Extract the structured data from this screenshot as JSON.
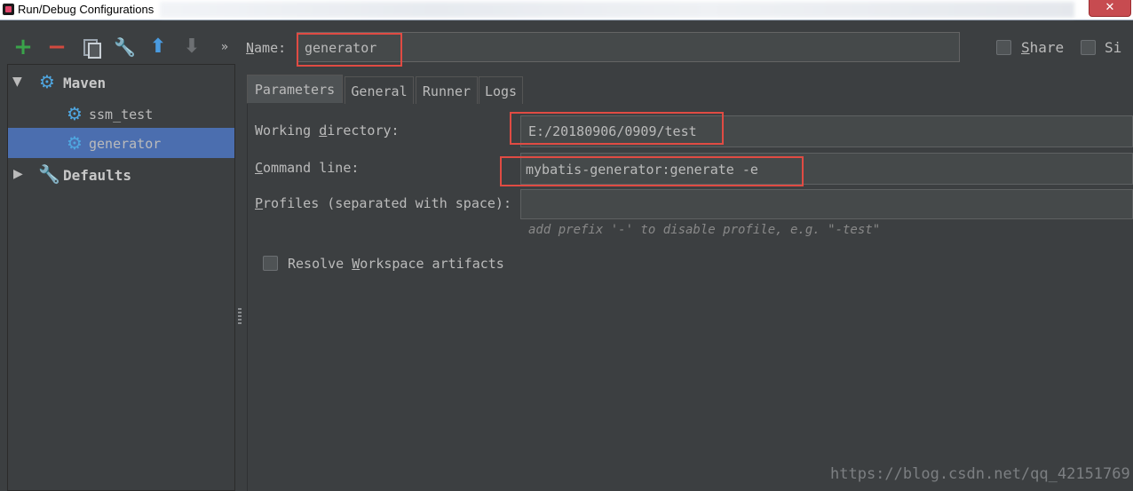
{
  "window": {
    "title": "Run/Debug Configurations",
    "close_glyph": "✕"
  },
  "toolbar": {
    "add": "+",
    "remove": "−",
    "copy_icon": "copy-icon",
    "edit_defaults_icon": "wrench-icon",
    "move_up": "⬆",
    "move_down": "⬇",
    "more": "»"
  },
  "name": {
    "label": "Name:",
    "value": "generator"
  },
  "options": {
    "share": "Share",
    "single": "Si"
  },
  "tree": {
    "maven": {
      "label": "Maven",
      "expanded": true
    },
    "items": [
      {
        "label": "ssm_test"
      },
      {
        "label": "generator",
        "selected": true
      }
    ],
    "defaults": {
      "label": "Defaults",
      "expanded": false
    }
  },
  "tabs": [
    {
      "label": "Parameters",
      "active": true
    },
    {
      "label": "General"
    },
    {
      "label": "Runner"
    },
    {
      "label": "Logs"
    }
  ],
  "params": {
    "working_directory_label": "Working directory:",
    "working_directory": "E:/20180906/0909/test",
    "command_line_label": "Command line:",
    "command_line": "mybatis-generator:generate -e",
    "profiles_label": "Profiles (separated with space):",
    "profiles": "",
    "profiles_hint": "add prefix '-' to disable profile, e.g. \"-test\"",
    "resolve_workspace": "Resolve Workspace artifacts",
    "resolve_workspace_checked": false
  },
  "watermark": "https://blog.csdn.net/qq_42151769",
  "colors": {
    "highlight": "#e04b43",
    "selection": "#4b6eaf",
    "background": "#3c3f41"
  }
}
